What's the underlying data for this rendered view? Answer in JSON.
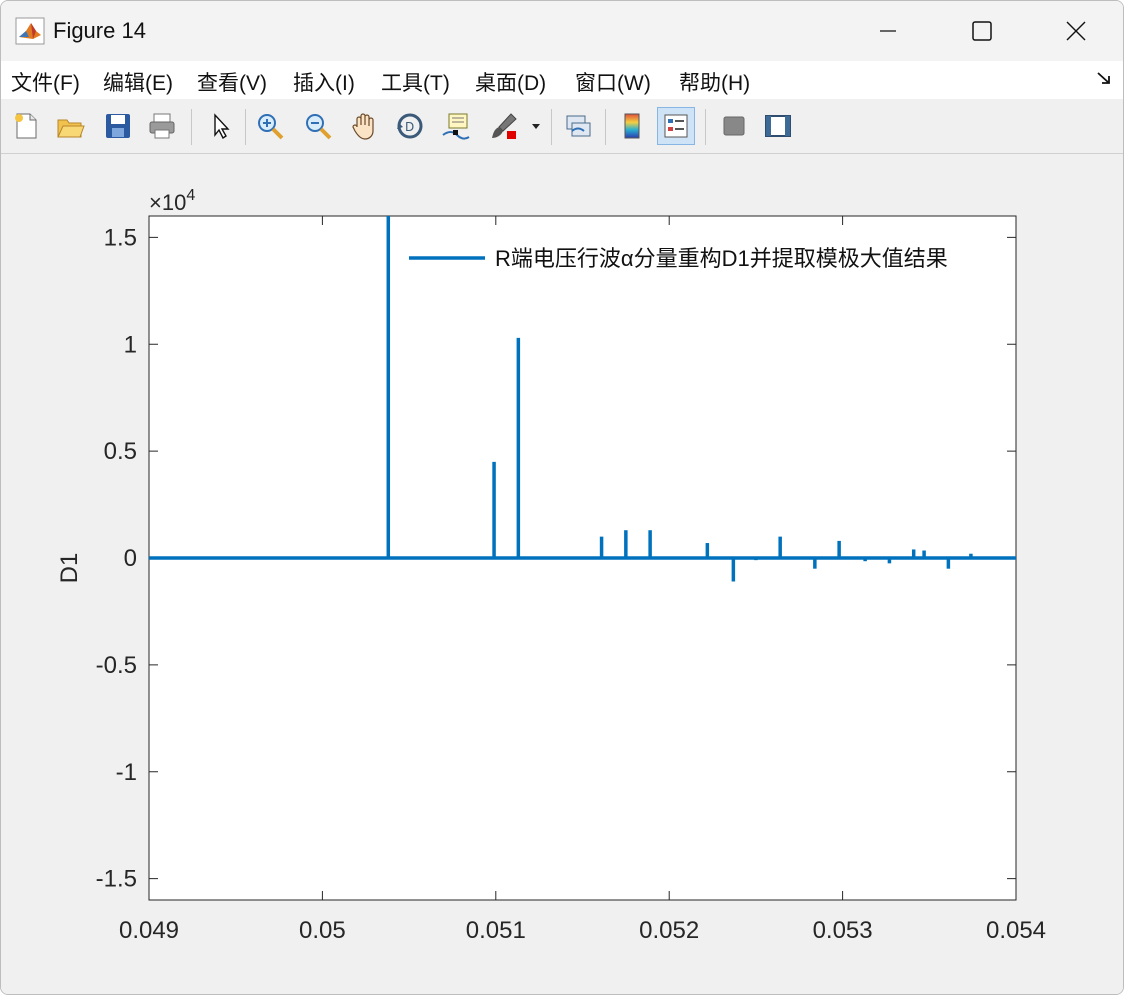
{
  "window": {
    "title": "Figure 14"
  },
  "menu": {
    "items": [
      {
        "label": "文件(F)"
      },
      {
        "label": "编辑(E)"
      },
      {
        "label": "查看(V)"
      },
      {
        "label": "插入(I)"
      },
      {
        "label": "工具(T)"
      },
      {
        "label": "桌面(D)"
      },
      {
        "label": "窗口(W)"
      },
      {
        "label": "帮助(H)"
      }
    ]
  },
  "toolbar": {
    "buttons": [
      {
        "icon": "new-figure-icon"
      },
      {
        "icon": "open-file-icon"
      },
      {
        "icon": "save-icon"
      },
      {
        "icon": "print-icon"
      },
      {
        "icon": "edit-plot-arrow-icon"
      },
      {
        "icon": "zoom-in-icon"
      },
      {
        "icon": "zoom-out-icon"
      },
      {
        "icon": "pan-hand-icon"
      },
      {
        "icon": "rotate-3d-icon"
      },
      {
        "icon": "data-cursor-icon"
      },
      {
        "icon": "brush-icon"
      },
      {
        "icon": "link-plot-icon"
      },
      {
        "icon": "colorbar-icon"
      },
      {
        "icon": "legend-icon"
      },
      {
        "icon": "hide-plot-tools-icon"
      },
      {
        "icon": "show-plot-tools-icon"
      }
    ]
  },
  "chart_data": {
    "type": "line",
    "title": "",
    "xlabel": "",
    "ylabel": "D1",
    "exponent_label": "×10",
    "exponent_power": "4",
    "xlim": [
      0.049,
      0.054
    ],
    "ylim": [
      -16000,
      16000
    ],
    "xticks": [
      0.049,
      0.05,
      0.051,
      0.052,
      0.053,
      0.054
    ],
    "xtick_labels": [
      "0.049",
      "0.05",
      "0.051",
      "0.052",
      "0.053",
      "0.054"
    ],
    "yticks": [
      -15000,
      -10000,
      -5000,
      0,
      5000,
      10000,
      15000
    ],
    "ytick_labels": [
      "-1.5",
      "-1",
      "-0.5",
      "0",
      "0.5",
      "1",
      "1.5"
    ],
    "grid": false,
    "legend_position": "top-right",
    "color": "#0072BD",
    "series": [
      {
        "name": "R端电压行波α分量重构D1并提取模极大值结果",
        "spikes": [
          {
            "x": 0.05038,
            "y": 16000
          },
          {
            "x": 0.05099,
            "y": 4500
          },
          {
            "x": 0.05113,
            "y": 10300
          },
          {
            "x": 0.05161,
            "y": 1000
          },
          {
            "x": 0.05175,
            "y": 1300
          },
          {
            "x": 0.05189,
            "y": 1300
          },
          {
            "x": 0.05222,
            "y": 700
          },
          {
            "x": 0.05237,
            "y": -1100
          },
          {
            "x": 0.0525,
            "y": -100
          },
          {
            "x": 0.05264,
            "y": 1000
          },
          {
            "x": 0.05284,
            "y": -500
          },
          {
            "x": 0.05298,
            "y": 800
          },
          {
            "x": 0.05313,
            "y": -150
          },
          {
            "x": 0.05327,
            "y": -250
          },
          {
            "x": 0.05341,
            "y": 400
          },
          {
            "x": 0.05347,
            "y": 350
          },
          {
            "x": 0.05361,
            "y": -500
          },
          {
            "x": 0.05374,
            "y": 200
          }
        ]
      }
    ]
  }
}
